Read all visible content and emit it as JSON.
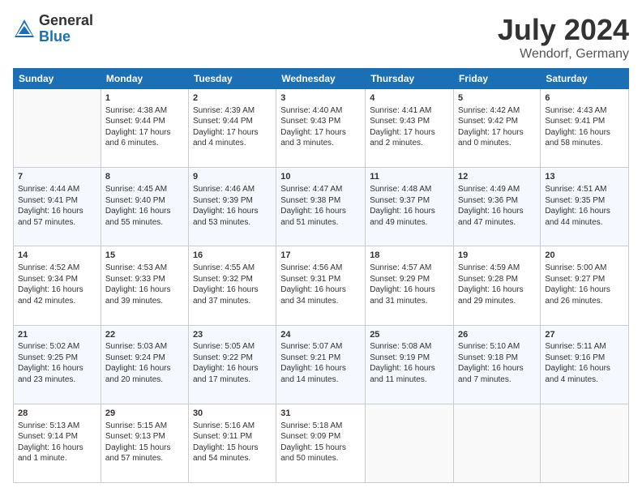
{
  "header": {
    "logo_general": "General",
    "logo_blue": "Blue",
    "month": "July 2024",
    "location": "Wendorf, Germany"
  },
  "days_of_week": [
    "Sunday",
    "Monday",
    "Tuesday",
    "Wednesday",
    "Thursday",
    "Friday",
    "Saturday"
  ],
  "weeks": [
    [
      {
        "day": "",
        "sunrise": "",
        "sunset": "",
        "daylight": ""
      },
      {
        "day": "1",
        "sunrise": "Sunrise: 4:38 AM",
        "sunset": "Sunset: 9:44 PM",
        "daylight": "Daylight: 17 hours and 6 minutes."
      },
      {
        "day": "2",
        "sunrise": "Sunrise: 4:39 AM",
        "sunset": "Sunset: 9:44 PM",
        "daylight": "Daylight: 17 hours and 4 minutes."
      },
      {
        "day": "3",
        "sunrise": "Sunrise: 4:40 AM",
        "sunset": "Sunset: 9:43 PM",
        "daylight": "Daylight: 17 hours and 3 minutes."
      },
      {
        "day": "4",
        "sunrise": "Sunrise: 4:41 AM",
        "sunset": "Sunset: 9:43 PM",
        "daylight": "Daylight: 17 hours and 2 minutes."
      },
      {
        "day": "5",
        "sunrise": "Sunrise: 4:42 AM",
        "sunset": "Sunset: 9:42 PM",
        "daylight": "Daylight: 17 hours and 0 minutes."
      },
      {
        "day": "6",
        "sunrise": "Sunrise: 4:43 AM",
        "sunset": "Sunset: 9:41 PM",
        "daylight": "Daylight: 16 hours and 58 minutes."
      }
    ],
    [
      {
        "day": "7",
        "sunrise": "Sunrise: 4:44 AM",
        "sunset": "Sunset: 9:41 PM",
        "daylight": "Daylight: 16 hours and 57 minutes."
      },
      {
        "day": "8",
        "sunrise": "Sunrise: 4:45 AM",
        "sunset": "Sunset: 9:40 PM",
        "daylight": "Daylight: 16 hours and 55 minutes."
      },
      {
        "day": "9",
        "sunrise": "Sunrise: 4:46 AM",
        "sunset": "Sunset: 9:39 PM",
        "daylight": "Daylight: 16 hours and 53 minutes."
      },
      {
        "day": "10",
        "sunrise": "Sunrise: 4:47 AM",
        "sunset": "Sunset: 9:38 PM",
        "daylight": "Daylight: 16 hours and 51 minutes."
      },
      {
        "day": "11",
        "sunrise": "Sunrise: 4:48 AM",
        "sunset": "Sunset: 9:37 PM",
        "daylight": "Daylight: 16 hours and 49 minutes."
      },
      {
        "day": "12",
        "sunrise": "Sunrise: 4:49 AM",
        "sunset": "Sunset: 9:36 PM",
        "daylight": "Daylight: 16 hours and 47 minutes."
      },
      {
        "day": "13",
        "sunrise": "Sunrise: 4:51 AM",
        "sunset": "Sunset: 9:35 PM",
        "daylight": "Daylight: 16 hours and 44 minutes."
      }
    ],
    [
      {
        "day": "14",
        "sunrise": "Sunrise: 4:52 AM",
        "sunset": "Sunset: 9:34 PM",
        "daylight": "Daylight: 16 hours and 42 minutes."
      },
      {
        "day": "15",
        "sunrise": "Sunrise: 4:53 AM",
        "sunset": "Sunset: 9:33 PM",
        "daylight": "Daylight: 16 hours and 39 minutes."
      },
      {
        "day": "16",
        "sunrise": "Sunrise: 4:55 AM",
        "sunset": "Sunset: 9:32 PM",
        "daylight": "Daylight: 16 hours and 37 minutes."
      },
      {
        "day": "17",
        "sunrise": "Sunrise: 4:56 AM",
        "sunset": "Sunset: 9:31 PM",
        "daylight": "Daylight: 16 hours and 34 minutes."
      },
      {
        "day": "18",
        "sunrise": "Sunrise: 4:57 AM",
        "sunset": "Sunset: 9:29 PM",
        "daylight": "Daylight: 16 hours and 31 minutes."
      },
      {
        "day": "19",
        "sunrise": "Sunrise: 4:59 AM",
        "sunset": "Sunset: 9:28 PM",
        "daylight": "Daylight: 16 hours and 29 minutes."
      },
      {
        "day": "20",
        "sunrise": "Sunrise: 5:00 AM",
        "sunset": "Sunset: 9:27 PM",
        "daylight": "Daylight: 16 hours and 26 minutes."
      }
    ],
    [
      {
        "day": "21",
        "sunrise": "Sunrise: 5:02 AM",
        "sunset": "Sunset: 9:25 PM",
        "daylight": "Daylight: 16 hours and 23 minutes."
      },
      {
        "day": "22",
        "sunrise": "Sunrise: 5:03 AM",
        "sunset": "Sunset: 9:24 PM",
        "daylight": "Daylight: 16 hours and 20 minutes."
      },
      {
        "day": "23",
        "sunrise": "Sunrise: 5:05 AM",
        "sunset": "Sunset: 9:22 PM",
        "daylight": "Daylight: 16 hours and 17 minutes."
      },
      {
        "day": "24",
        "sunrise": "Sunrise: 5:07 AM",
        "sunset": "Sunset: 9:21 PM",
        "daylight": "Daylight: 16 hours and 14 minutes."
      },
      {
        "day": "25",
        "sunrise": "Sunrise: 5:08 AM",
        "sunset": "Sunset: 9:19 PM",
        "daylight": "Daylight: 16 hours and 11 minutes."
      },
      {
        "day": "26",
        "sunrise": "Sunrise: 5:10 AM",
        "sunset": "Sunset: 9:18 PM",
        "daylight": "Daylight: 16 hours and 7 minutes."
      },
      {
        "day": "27",
        "sunrise": "Sunrise: 5:11 AM",
        "sunset": "Sunset: 9:16 PM",
        "daylight": "Daylight: 16 hours and 4 minutes."
      }
    ],
    [
      {
        "day": "28",
        "sunrise": "Sunrise: 5:13 AM",
        "sunset": "Sunset: 9:14 PM",
        "daylight": "Daylight: 16 hours and 1 minute."
      },
      {
        "day": "29",
        "sunrise": "Sunrise: 5:15 AM",
        "sunset": "Sunset: 9:13 PM",
        "daylight": "Daylight: 15 hours and 57 minutes."
      },
      {
        "day": "30",
        "sunrise": "Sunrise: 5:16 AM",
        "sunset": "Sunset: 9:11 PM",
        "daylight": "Daylight: 15 hours and 54 minutes."
      },
      {
        "day": "31",
        "sunrise": "Sunrise: 5:18 AM",
        "sunset": "Sunset: 9:09 PM",
        "daylight": "Daylight: 15 hours and 50 minutes."
      },
      {
        "day": "",
        "sunrise": "",
        "sunset": "",
        "daylight": ""
      },
      {
        "day": "",
        "sunrise": "",
        "sunset": "",
        "daylight": ""
      },
      {
        "day": "",
        "sunrise": "",
        "sunset": "",
        "daylight": ""
      }
    ]
  ]
}
